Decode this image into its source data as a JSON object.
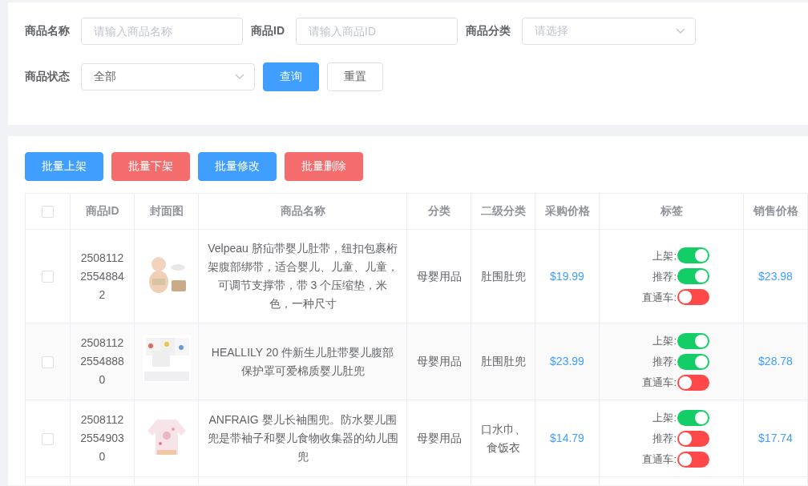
{
  "filters": [
    {
      "label": "商品名称",
      "kind": "input",
      "placeholder": "请输入商品名称"
    },
    {
      "label": "商品ID",
      "kind": "input",
      "placeholder": "请输入商品ID"
    },
    {
      "label": "商品分类",
      "kind": "select",
      "placeholder": "请选择"
    },
    {
      "label": "商品状态",
      "kind": "select",
      "value": "全部"
    }
  ],
  "filter_buttons": [
    {
      "label": "查询",
      "kind": "primary"
    },
    {
      "label": "重置",
      "kind": "plain"
    }
  ],
  "batch_buttons": [
    {
      "label": "批量上架",
      "kind": "primary"
    },
    {
      "label": "批量下架",
      "kind": "danger"
    },
    {
      "label": "批量修改",
      "kind": "primary"
    },
    {
      "label": "批量删除",
      "kind": "danger"
    }
  ],
  "table": {
    "header_checked": false,
    "columns": [
      "商品ID",
      "封面图",
      "商品名称",
      "分类",
      "二级分类",
      "采购价格",
      "标签",
      "销售价格"
    ],
    "rows": [
      {
        "checked": false,
        "id": "2508112 2554884 2",
        "image": {
          "kind": "picture"
        },
        "name": "Velpeau 脐疝带婴儿肚带，纽扣包裹桁架腹部绑带，适合婴儿、儿童、儿童，可调节支撑带，带 3 个压缩垫，米色，一种尺寸",
        "category": "母婴用品",
        "subcategory": "肚围肚兜",
        "purchase_price": "$19.99",
        "tags": [
          {
            "label": "上架:",
            "on": true
          },
          {
            "label": "推荐:",
            "on": true
          },
          {
            "label": "直通车:",
            "on": false
          }
        ],
        "sale_price": "$23.98"
      },
      {
        "checked": false,
        "id": "2508112 2554888 0",
        "image": {
          "kind": "picture"
        },
        "name": "HEALLILY 20 件新生儿肚带婴儿腹部保护罩可爱棉质婴儿肚兜",
        "category": "母婴用品",
        "subcategory": "肚围肚兜",
        "purchase_price": "$23.99",
        "tags": [
          {
            "label": "上架:",
            "on": true
          },
          {
            "label": "推荐:",
            "on": true
          },
          {
            "label": "直通车:",
            "on": false
          }
        ],
        "sale_price": "$28.78"
      },
      {
        "checked": false,
        "id": "2508112 2554903 0",
        "image": {
          "kind": "picture"
        },
        "name": "ANFRAIG 婴儿长袖围兜。防水婴儿围兜是带袖子和婴儿食物收集器的幼儿围兜",
        "category": "母婴用品",
        "subcategory": "口水巾、食饭衣",
        "purchase_price": "$14.79",
        "tags": [
          {
            "label": "上架:",
            "on": true
          },
          {
            "label": "推荐:",
            "on": false
          },
          {
            "label": "直通车:",
            "on": false
          }
        ],
        "sale_price": "$17.74"
      }
    ]
  }
}
